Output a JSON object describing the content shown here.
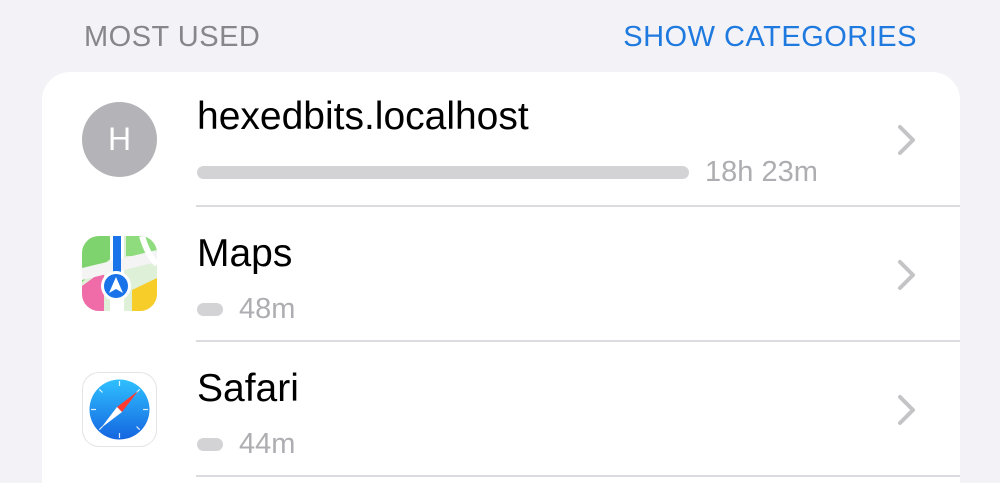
{
  "section": {
    "title": "MOST USED",
    "action_label": "SHOW CATEGORIES",
    "accent_color": "#1f7ae0"
  },
  "rows": [
    {
      "title": "hexedbits.localhost",
      "icon": "avatar-letter",
      "avatar_letter": "H",
      "time": "18h 23m",
      "usage_fraction": 1.0
    },
    {
      "title": "Maps",
      "icon": "maps-app-icon",
      "time": "48m",
      "usage_fraction": 0.04
    },
    {
      "title": "Safari",
      "icon": "safari-app-icon",
      "time": "44m",
      "usage_fraction": 0.04
    }
  ]
}
